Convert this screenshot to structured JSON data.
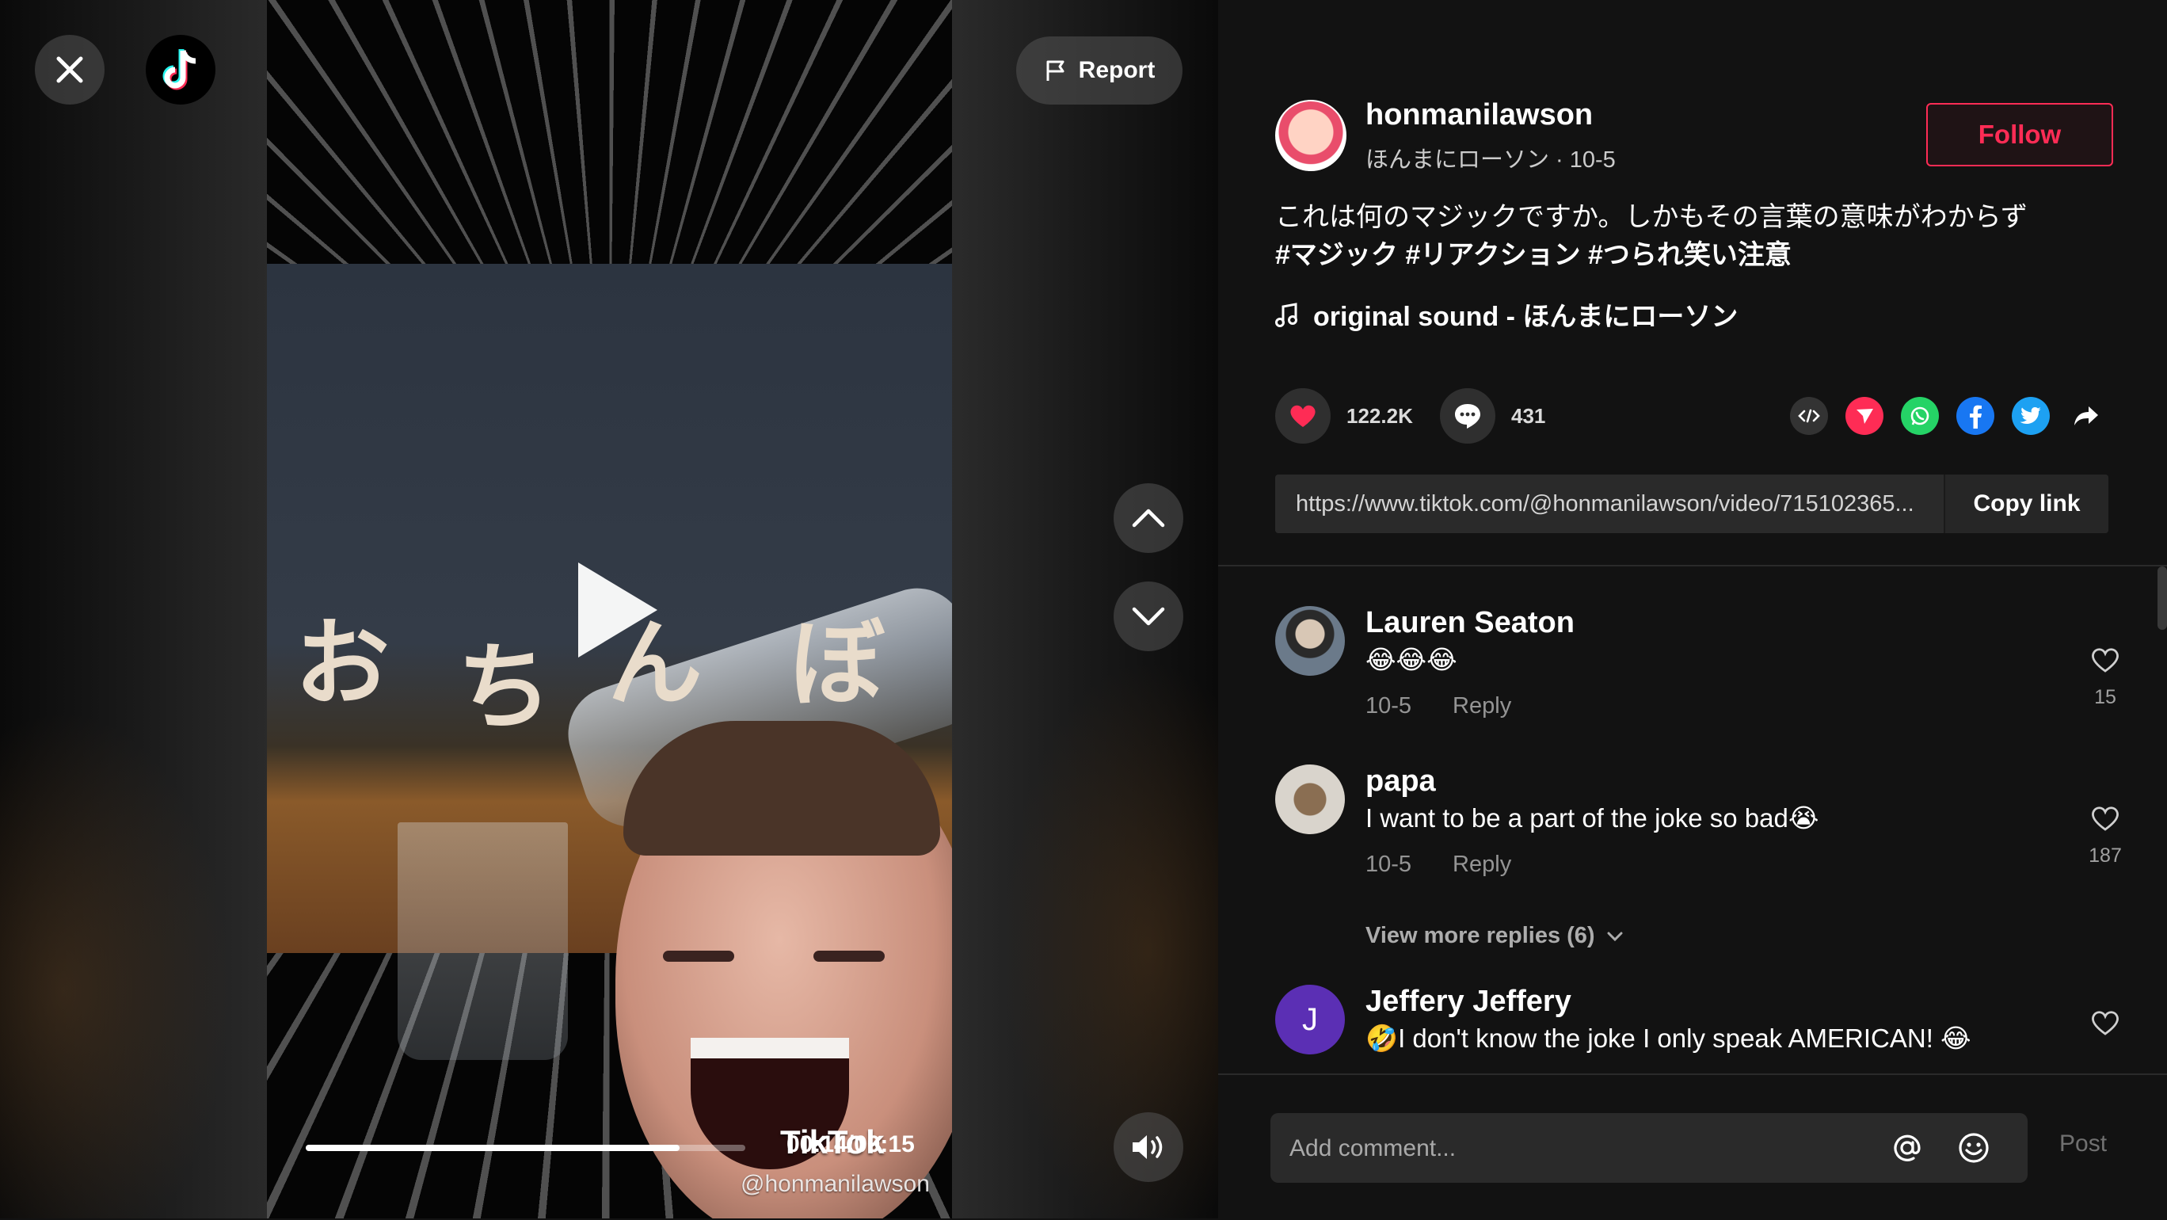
{
  "video": {
    "report_label": "Report",
    "time_display": "00:14/00:15",
    "progress": 0.85,
    "watermark_logo": "TikTok",
    "watermark_user": "@honmanilawson",
    "overlay_kana": [
      "お",
      "ち",
      "ん",
      "ぼ"
    ]
  },
  "author": {
    "username": "honmanilawson",
    "subline": "ほんまにローソン · 10-5",
    "follow_label": "Follow"
  },
  "caption": {
    "text": "これは何のマジックですか。しかもその言葉の意味がわからず",
    "hashtags": "#マジック #リアクション #つられ笑い注意"
  },
  "music": {
    "label": "original sound - ほんまにローソン"
  },
  "stats": {
    "likes": "122.2K",
    "comments": "431"
  },
  "share": {
    "icons": [
      "embed-icon",
      "send-icon",
      "whatsapp-icon",
      "facebook-icon",
      "twitter-icon",
      "share-arrow-icon"
    ]
  },
  "link": {
    "url": "https://www.tiktok.com/@honmanilawson/video/715102365...",
    "copy_label": "Copy link"
  },
  "comments": [
    {
      "name": "Lauren Seaton",
      "text": "😂😂😂",
      "date": "10-5",
      "reply": "Reply",
      "likes": "15"
    },
    {
      "name": "papa",
      "text": "I want to be a part of the joke so bad😭",
      "date": "10-5",
      "reply": "Reply",
      "likes": "187"
    },
    {
      "name": "Jeffery Jeffery",
      "text": "🤣I don't know the joke I only speak AMERICAN! 😂",
      "avatar_letter": "J"
    }
  ],
  "view_more": "View more replies (6)",
  "compose": {
    "placeholder": "Add comment...",
    "post_label": "Post"
  },
  "colors": {
    "accent": "#fe2c55",
    "panel_bg": "#121212"
  }
}
